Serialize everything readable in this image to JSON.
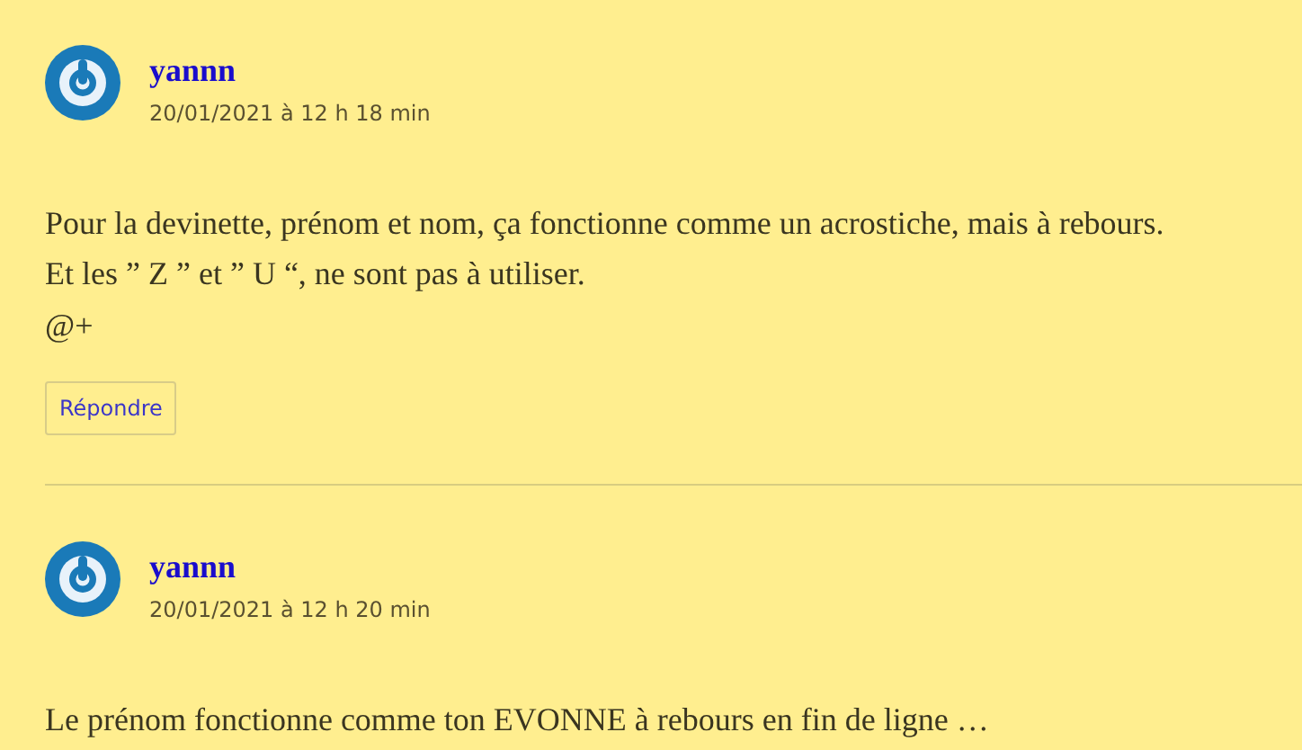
{
  "comments": [
    {
      "author": "yannn",
      "date": "20/01/2021 à 12 h 18 min",
      "lines": [
        "Pour la devinette, prénom et nom, ça fonctionne comme un acrostiche, mais à rebours.",
        "Et les ” Z ” et ” U “, ne sont pas à utiliser.",
        "@+"
      ],
      "reply": "Répondre"
    },
    {
      "author": "yannn",
      "date": "20/01/2021 à 12 h 20 min",
      "lines": [
        "Le prénom fonctionne comme ton EVONNE à rebours en fin de ligne …"
      ]
    }
  ]
}
